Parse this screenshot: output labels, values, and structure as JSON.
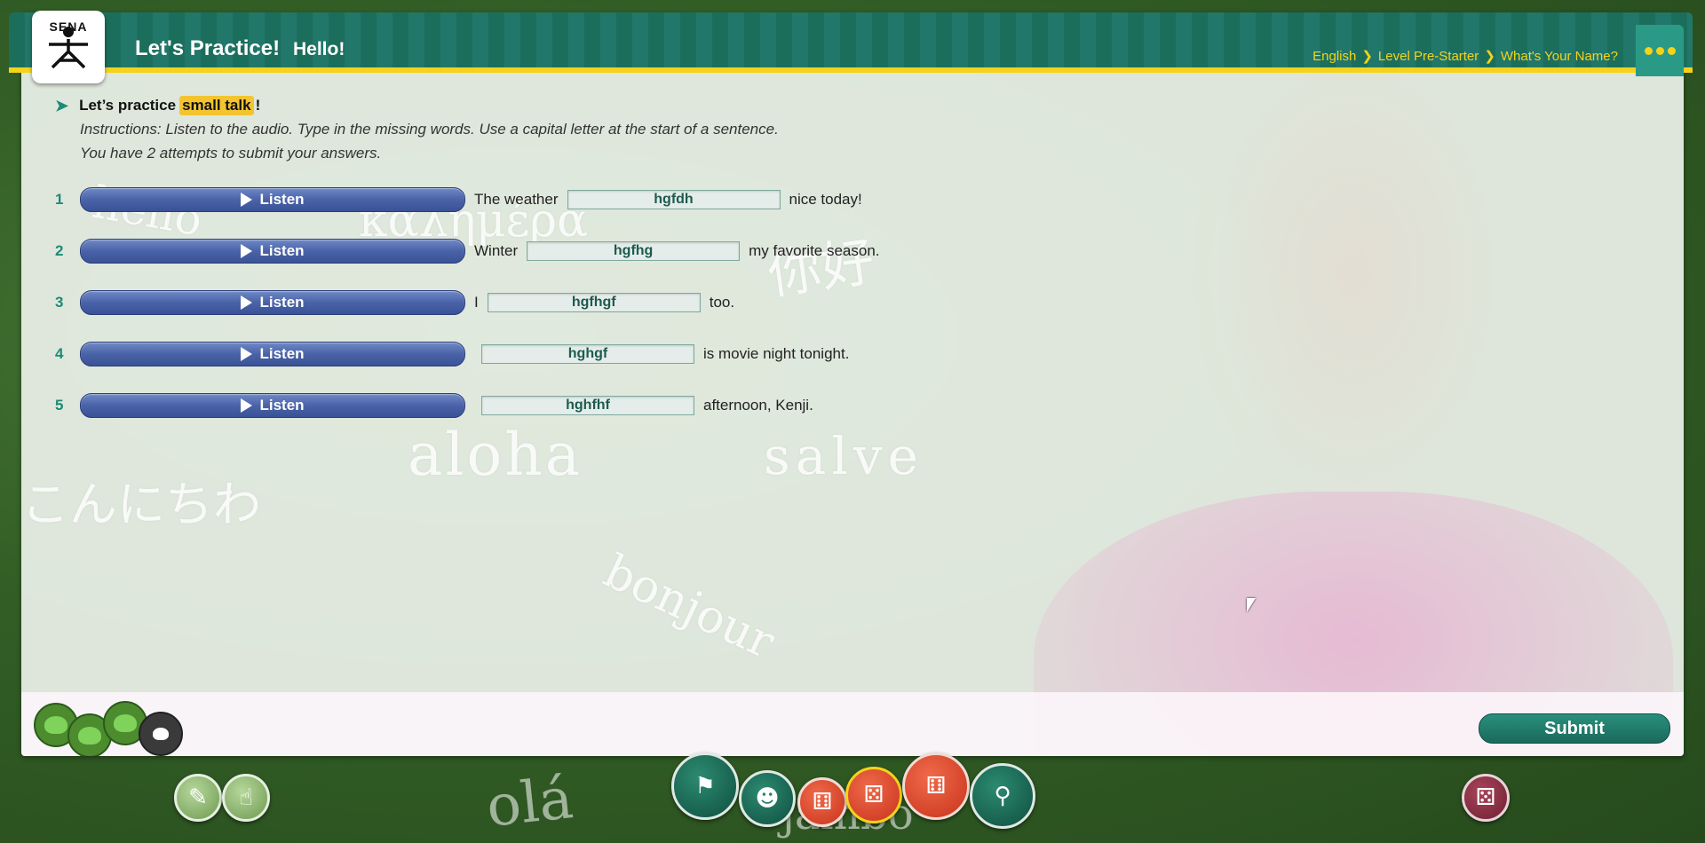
{
  "header": {
    "title": "Let's Practice!",
    "subtitle": "Hello!",
    "logo_text": "SENA",
    "breadcrumbs": [
      "English",
      "Level Pre-Starter",
      "What's Your Name?"
    ]
  },
  "intro": {
    "lead_prefix": "Let’s practice",
    "lead_highlight": "small talk",
    "lead_suffix": "!",
    "instruction_1": "Instructions: Listen to the audio. Type in the missing words. Use a capital letter at the start of a sentence.",
    "instruction_2": "You have 2 attempts to submit your answers."
  },
  "listen_label": "Listen",
  "items": [
    {
      "num": "1",
      "before": "The weather",
      "value": "hgfdh",
      "after": "nice today!"
    },
    {
      "num": "2",
      "before": "Winter",
      "value": "hgfhg",
      "after": "my favorite season."
    },
    {
      "num": "3",
      "before": "I",
      "value": "hgfhgf",
      "after": "too."
    },
    {
      "num": "4",
      "before": "",
      "value": "hghgf",
      "after": "is movie night tonight."
    },
    {
      "num": "5",
      "before": "",
      "value": "hghfhf",
      "after": "afternoon, Kenji."
    }
  ],
  "submit_label": "Submit",
  "background_words": [
    "hello",
    "καλημέρα",
    "你好",
    "aloha",
    "salve",
    "こんにちわ",
    "bonjour",
    "olá",
    "jambo"
  ],
  "colors": {
    "header_green": "#1c6e5c",
    "accent_yellow": "#f4d31a",
    "listen_blue": "#4a63a8",
    "submit_green": "#1a6a5b"
  },
  "toolbar_icons": [
    "flag-icon",
    "pilot-icon",
    "die-icon",
    "dice-icon",
    "dice-stack-icon",
    "search-help-icon"
  ]
}
